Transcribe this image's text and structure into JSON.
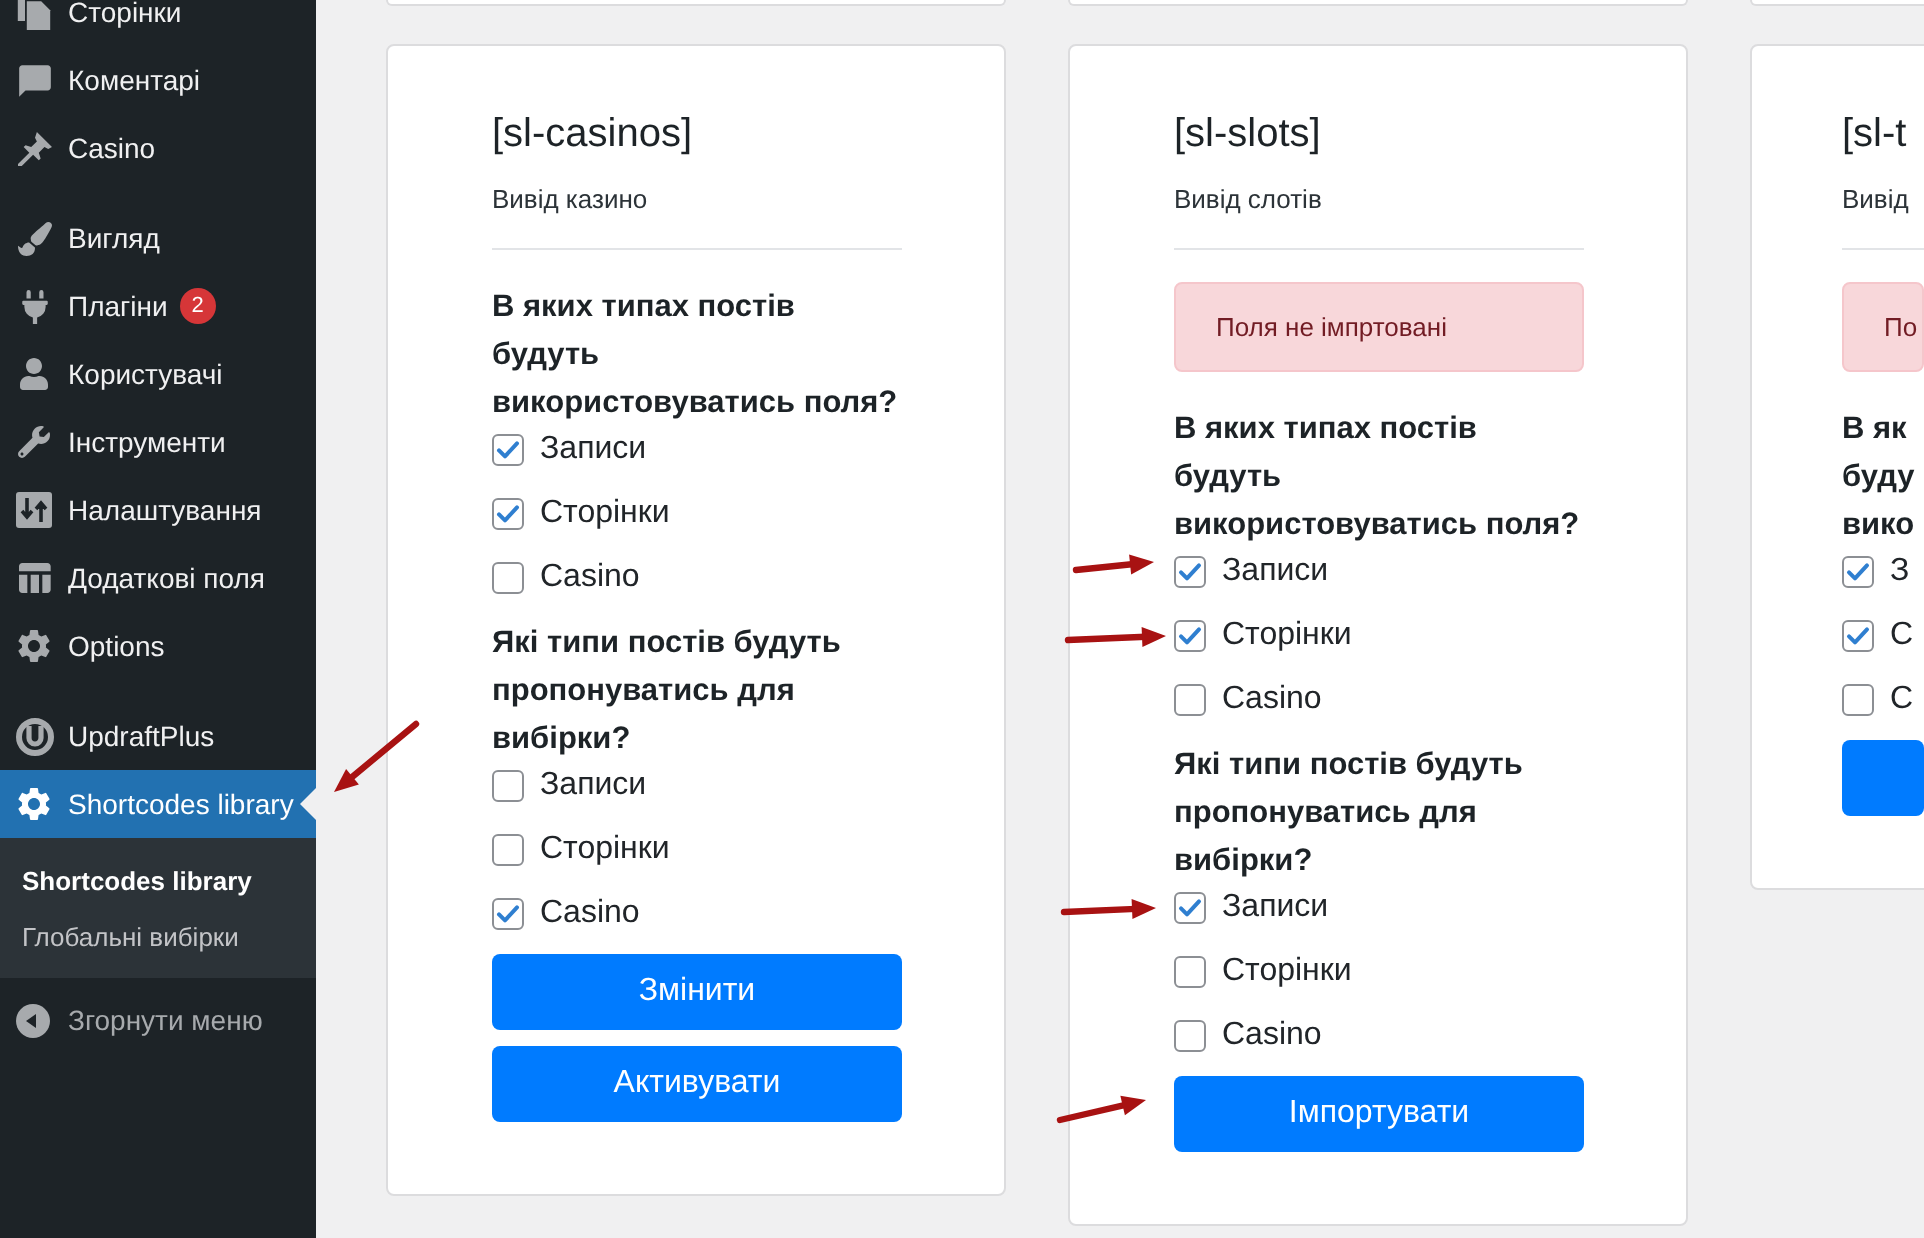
{
  "sidebar": {
    "groups": [
      {
        "items": [
          {
            "label": "Сторінки",
            "selected": false
          },
          {
            "label": "Коментарі",
            "selected": false
          },
          {
            "label": "Casino",
            "selected": false
          }
        ]
      },
      {
        "items": [
          {
            "label": "Вигляд",
            "selected": false
          },
          {
            "label": "Плагіни",
            "selected": false,
            "badge": "2"
          },
          {
            "label": "Користувачі",
            "selected": false
          },
          {
            "label": "Інструменти",
            "selected": false
          },
          {
            "label": "Налаштування",
            "selected": false
          },
          {
            "label": "Додаткові поля",
            "selected": false
          },
          {
            "label": "Options",
            "selected": false
          }
        ]
      },
      {
        "items": [
          {
            "label": "UpdraftPlus",
            "selected": false
          },
          {
            "label": "Shortcodes library",
            "selected": true,
            "children": [
              {
                "label": "Shortcodes library",
                "selected": true
              },
              {
                "label": "Глобальні вибірки",
                "selected": false
              }
            ]
          }
        ]
      }
    ],
    "collapse_label": "Згорнути меню"
  },
  "cards": [
    {
      "title": "[sl-casinos]",
      "subtitle": "Вивід казино",
      "groups": [
        {
          "question": "В яких типах постів будуть використовуватись поля?",
          "options": [
            {
              "label": "Записи",
              "checked": true
            },
            {
              "label": "Сторінки",
              "checked": true
            },
            {
              "label": "Casino",
              "checked": false
            }
          ]
        },
        {
          "question": "Які типи постів будуть пропонуватись для вибірки?",
          "options": [
            {
              "label": "Записи",
              "checked": false
            },
            {
              "label": "Сторінки",
              "checked": false
            },
            {
              "label": "Casino",
              "checked": true
            }
          ]
        }
      ],
      "buttons": [
        {
          "kind": "primary",
          "label": "Змінити"
        },
        {
          "kind": "primary",
          "label": "Активувати"
        }
      ]
    },
    {
      "title": "[sl-slots]",
      "subtitle": "Вивід слотів",
      "alert": "Поля не імпртовані",
      "groups": [
        {
          "question": "В яких типах постів будуть використовуватись поля?",
          "options": [
            {
              "label": "Записи",
              "checked": true
            },
            {
              "label": "Сторінки",
              "checked": true
            },
            {
              "label": "Casino",
              "checked": false
            }
          ]
        },
        {
          "question": "Які типи постів будуть пропонуватись для вибірки?",
          "options": [
            {
              "label": "Записи",
              "checked": true
            },
            {
              "label": "Сторінки",
              "checked": false
            },
            {
              "label": "Casino",
              "checked": false
            }
          ]
        }
      ],
      "buttons": [
        {
          "kind": "primary",
          "label": "Імпортувати"
        }
      ]
    },
    {
      "title": "[sl-t",
      "subtitle": "Вивід",
      "alert": "По",
      "groups": [
        {
          "question": "В як буду вико",
          "options": [
            {
              "label": "З",
              "checked": true
            },
            {
              "label": "С",
              "checked": true
            },
            {
              "label": "С",
              "checked": false
            }
          ]
        }
      ],
      "buttons": [
        {
          "kind": "primary"
        }
      ]
    }
  ]
}
